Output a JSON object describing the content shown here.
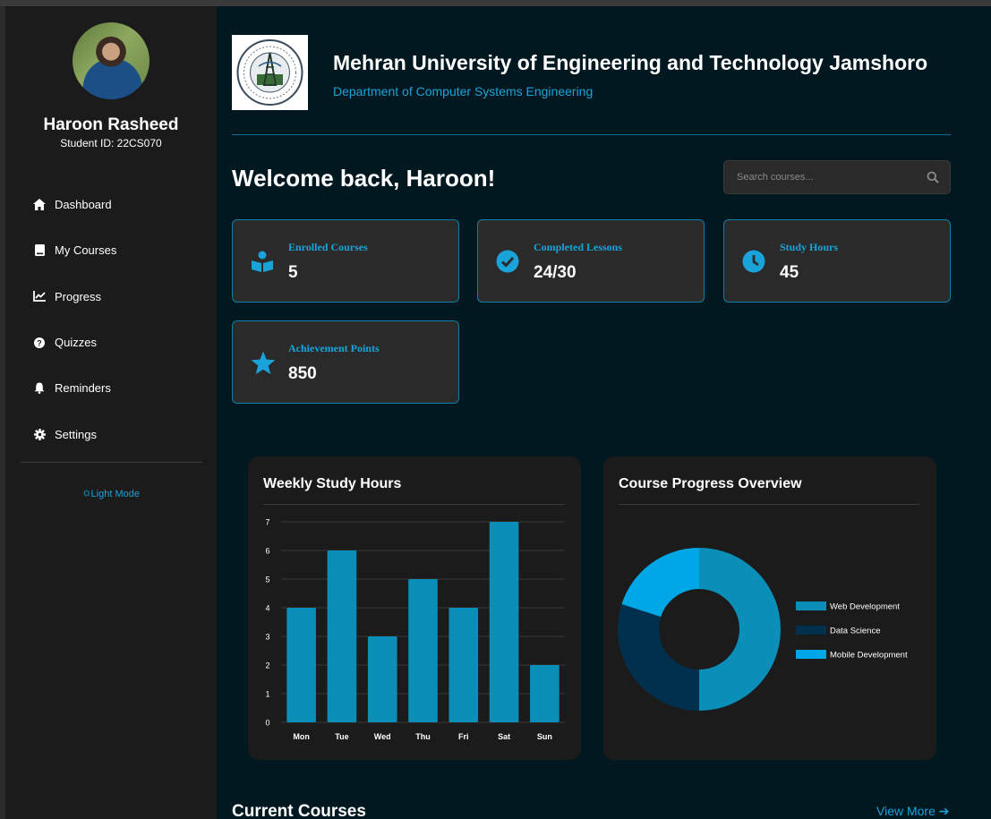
{
  "user": {
    "name": "Haroon Rasheed",
    "student_id": "Student ID: 22CS070"
  },
  "sidebar": {
    "items": [
      {
        "label": "Dashboard",
        "icon": "home-icon"
      },
      {
        "label": "My Courses",
        "icon": "book-icon"
      },
      {
        "label": "Progress",
        "icon": "chart-line-icon"
      },
      {
        "label": "Quizzes",
        "icon": "question-circle-icon"
      },
      {
        "label": "Reminders",
        "icon": "bell-icon"
      },
      {
        "label": "Settings",
        "icon": "gear-icon"
      }
    ],
    "mode_toggle": "🌣Light Mode"
  },
  "header": {
    "title": "Mehran University of Engineering and Technology Jamshoro",
    "department": "Department of Computer Systems Engineering"
  },
  "welcome": "Welcome back, Haroon!",
  "search": {
    "placeholder": "Search courses..."
  },
  "stats": [
    {
      "label": "Enrolled Courses",
      "value": "5",
      "icon": "book-reader-icon"
    },
    {
      "label": "Completed Lessons",
      "value": "24/30",
      "icon": "check-circle-icon"
    },
    {
      "label": "Study Hours",
      "value": "45",
      "icon": "clock-icon"
    },
    {
      "label": "Achievement Points",
      "value": "850",
      "icon": "star-icon"
    }
  ],
  "weekly_chart_title": "Weekly Study Hours",
  "progress_chart_title": "Course Progress Overview",
  "chart_data": [
    {
      "type": "bar",
      "title": "Weekly Study Hours",
      "categories": [
        "Mon",
        "Tue",
        "Wed",
        "Thu",
        "Fri",
        "Sat",
        "Sun"
      ],
      "values": [
        4,
        6,
        3,
        5,
        4,
        7,
        2
      ],
      "ylim": [
        0,
        7
      ],
      "yticks": [
        0,
        1,
        2,
        3,
        4,
        5,
        6,
        7
      ],
      "grid": true,
      "color": "#0b8fb8"
    },
    {
      "type": "pie",
      "title": "Course Progress Overview",
      "labels": [
        "Web Development",
        "Data Science",
        "Mobile Development"
      ],
      "values": [
        50,
        30,
        20
      ],
      "colors": [
        "#0b8fb8",
        "#00304e",
        "#00a7e6"
      ],
      "legend": "right"
    }
  ],
  "current_courses": {
    "title": "Current Courses",
    "view_more": "View More ➔"
  },
  "colors": {
    "accent": "#1aa3d9",
    "sidebar": "#1b1b1b",
    "main_bg": "#011820",
    "card_bg": "#2a2a2a"
  }
}
